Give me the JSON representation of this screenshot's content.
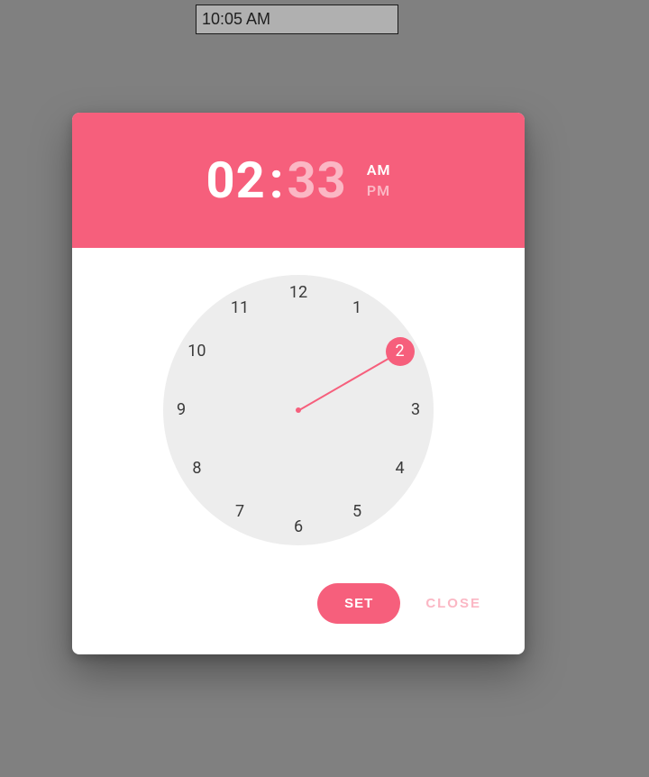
{
  "input": {
    "value": "10:05 AM"
  },
  "picker": {
    "hours": "02",
    "minutes": "33",
    "colon": ":",
    "active_segment": "hours",
    "am_label": "AM",
    "pm_label": "PM",
    "active_period": "AM",
    "selected_hour": 2,
    "hand_angle_deg": 60,
    "numerals": [
      "12",
      "1",
      "2",
      "3",
      "4",
      "5",
      "6",
      "7",
      "8",
      "9",
      "10",
      "11"
    ],
    "set_label": "SET",
    "close_label": "CLOSE"
  }
}
